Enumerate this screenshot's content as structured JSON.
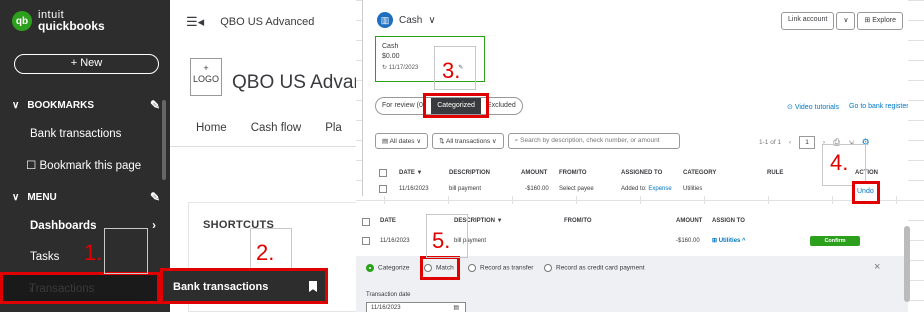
{
  "sidebar": {
    "logo_line1": "intuit",
    "logo_line2": "quickbooks",
    "logo_mark": "qb",
    "new_button": "+ New",
    "bookmarks": "BOOKMARKS",
    "bank_transactions": "Bank transactions",
    "bookmark_this_page": "Bookmark this page",
    "menu": "MENU",
    "dashboards": "Dashboards",
    "tasks": "Tasks",
    "transactions": "Transactions"
  },
  "flyout": {
    "label": "Bank transactions"
  },
  "middle": {
    "header": "QBO US Advanced",
    "logo_plus": "+",
    "logo_label": "LOGO",
    "company_name": "QBO US Advan",
    "tabs": [
      "Home",
      "Cash flow",
      "Pla"
    ],
    "shortcuts": "SHORTCUTS"
  },
  "account": {
    "name": "Cash",
    "link_account": "Link account",
    "explore": "Explore",
    "card_name": "Cash",
    "card_balance": "$0.00",
    "card_date": "11/17/2023"
  },
  "review_tabs": [
    "For review (0)",
    "Categorized",
    "Excluded"
  ],
  "links": {
    "video": "Video tutorials",
    "goto": "Go to bank register"
  },
  "filters": {
    "dates": "All dates",
    "txn": "All transactions",
    "search": "Search by description, check number, or amount",
    "page_of": "1-1 of 1",
    "page": "1"
  },
  "table_top": {
    "headers": [
      "DATE ▼",
      "DESCRIPTION",
      "AMOUNT",
      "FROM/TO",
      "ASSIGNED TO",
      "CATEGORY",
      "RULE",
      "ACTION"
    ],
    "row": {
      "date": "11/16/2023",
      "desc": "bill payment",
      "amount": "-$160.00",
      "from_to": "Select payee",
      "assigned": "Added to: ",
      "assigned_link": "Expense",
      "category": "Utilities",
      "action": "Undo"
    }
  },
  "table_bottom": {
    "headers": [
      "DATE",
      "DESCRIPTION ▼",
      "FROM/TO",
      "AMOUNT",
      "ASSIGN TO"
    ],
    "row": {
      "date": "11/16/2023",
      "desc": "bill payment",
      "amount": "-$160.00",
      "assign": "Utilities ^",
      "confirm": "Confirm"
    }
  },
  "match_panel": {
    "options": [
      "Categorize",
      "Match",
      "Record as transfer",
      "Record as credit card payment"
    ],
    "close": "×",
    "date_label": "Transaction date",
    "date_value": "11/16/2023"
  },
  "steps": [
    "1.",
    "2.",
    "3.",
    "4.",
    "5."
  ]
}
